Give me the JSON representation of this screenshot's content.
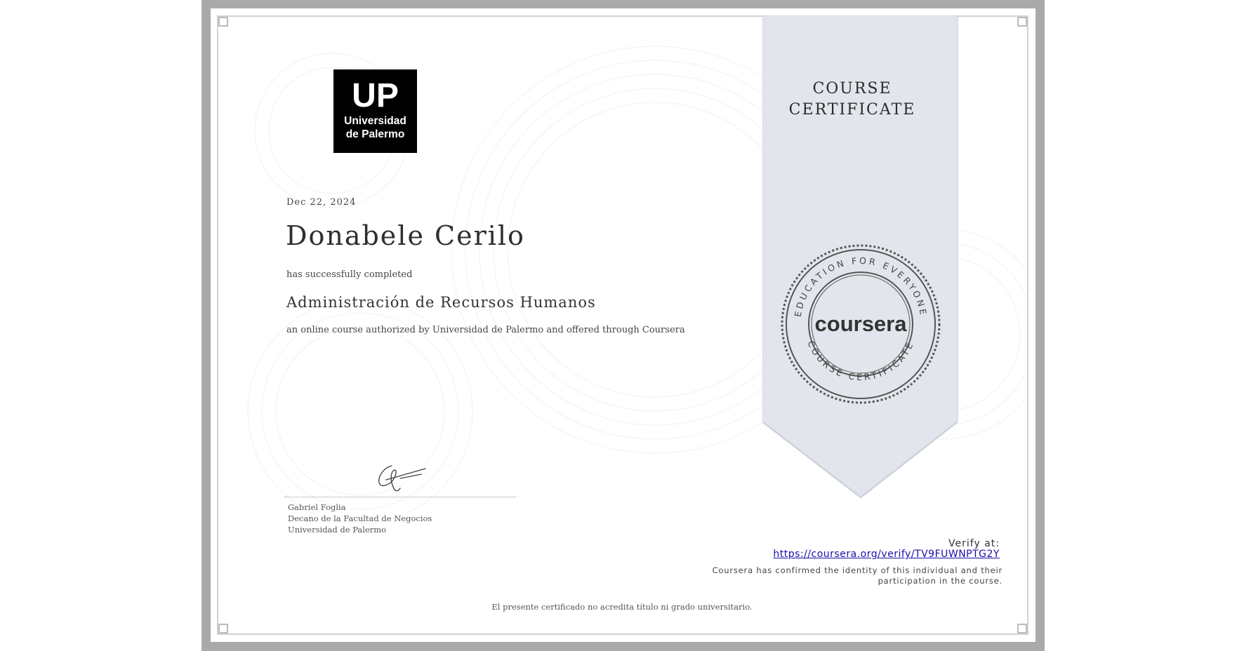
{
  "logo": {
    "icon": "universidad-de-palermo-logo",
    "line1": "UP",
    "line2": "Universidad",
    "line3": "de Palermo"
  },
  "date": "Dec 22, 2024",
  "recipient_name": "Donabele Cerilo",
  "completed_text": "has successfully completed",
  "course_title": "Administración de Recursos Humanos",
  "authorized_text": "an online course authorized by Universidad de Palermo and offered through Coursera",
  "signatory": {
    "name": "Gabriel Foglia",
    "title": "Decano de la Facultad de Negocios",
    "organization": "Universidad de Palermo"
  },
  "ribbon": {
    "line1": "COURSE",
    "line2": "CERTIFICATE",
    "color": "#e2e6ec"
  },
  "seal": {
    "brand": "coursera",
    "top_text": "EDUCATION FOR EVERYONE",
    "bottom_text": "COURSE CERTIFICATE",
    "icon": "coursera-seal-icon"
  },
  "verify": {
    "label": "Verify at:",
    "url": "https://coursera.org/verify/TV9FUWNPTG2Y",
    "confirm_line1": "Coursera has confirmed the identity of this individual and their",
    "confirm_line2": "participation in the course."
  },
  "disclaimer": "El presente certificado no acredita título ni grado universitario."
}
